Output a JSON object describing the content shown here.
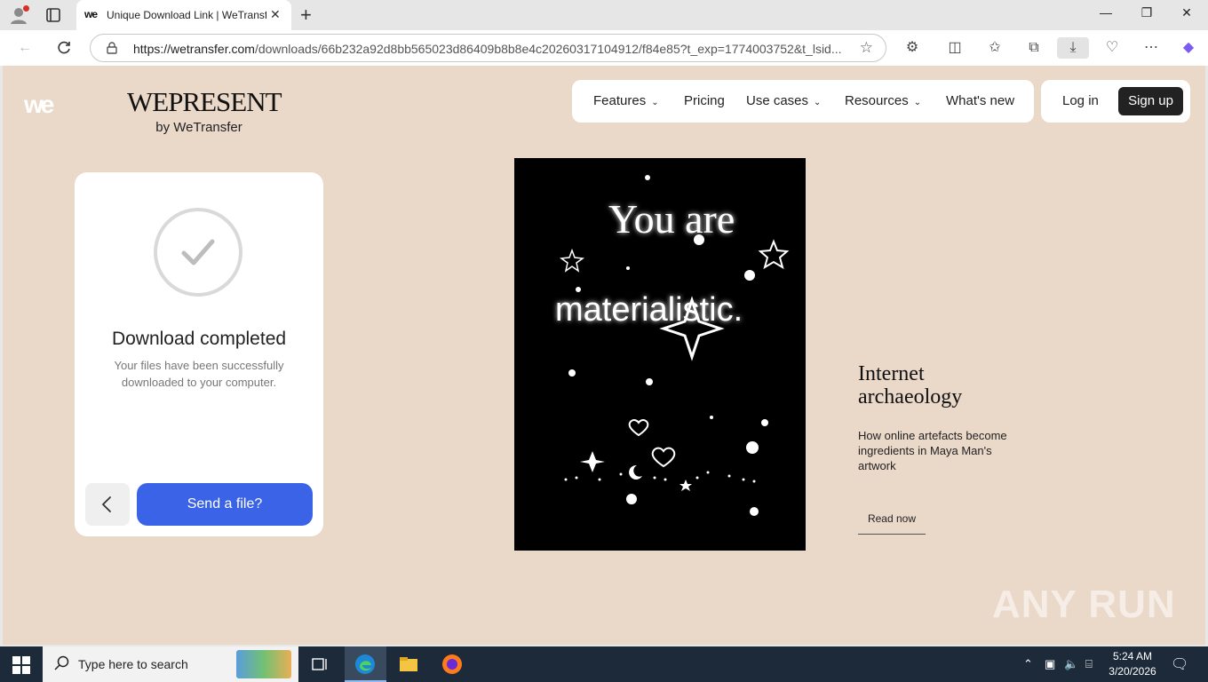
{
  "browser": {
    "tab_title": "Unique Download Link | WeTransfer",
    "tab_favicon_text": "we",
    "url_host": "https://wetransfer.com",
    "url_path": "/downloads/66b232a92d8bb565023d86409b8b8e4c20260317104912/f84e85?t_exp=1774003752&t_lsid..."
  },
  "site": {
    "logo_text": "we",
    "brand_name": "WEPRESENT",
    "brand_by": "by WeTransfer",
    "nav": {
      "features": "Features",
      "pricing": "Pricing",
      "use_cases": "Use cases",
      "resources": "Resources",
      "whats_new": "What's new"
    },
    "login": "Log in",
    "signup": "Sign up"
  },
  "download_card": {
    "heading": "Download completed",
    "subtext": "Your files have been successfully downloaded to your computer.",
    "send_button": "Send a file?"
  },
  "artwork": {
    "line1": "You are",
    "line2": "materialistic."
  },
  "story": {
    "title": "Internet archaeology",
    "description": "How online artefacts become ingredients in Maya Man's artwork",
    "link": "Read now"
  },
  "watermark": "ANY RUN",
  "taskbar": {
    "search_placeholder": "Type here to search",
    "time": "5:24 AM",
    "date": "3/20/2026"
  },
  "colors": {
    "page_bg": "#ead8c9",
    "send_button": "#3b63e8",
    "signup_button": "#222222"
  }
}
